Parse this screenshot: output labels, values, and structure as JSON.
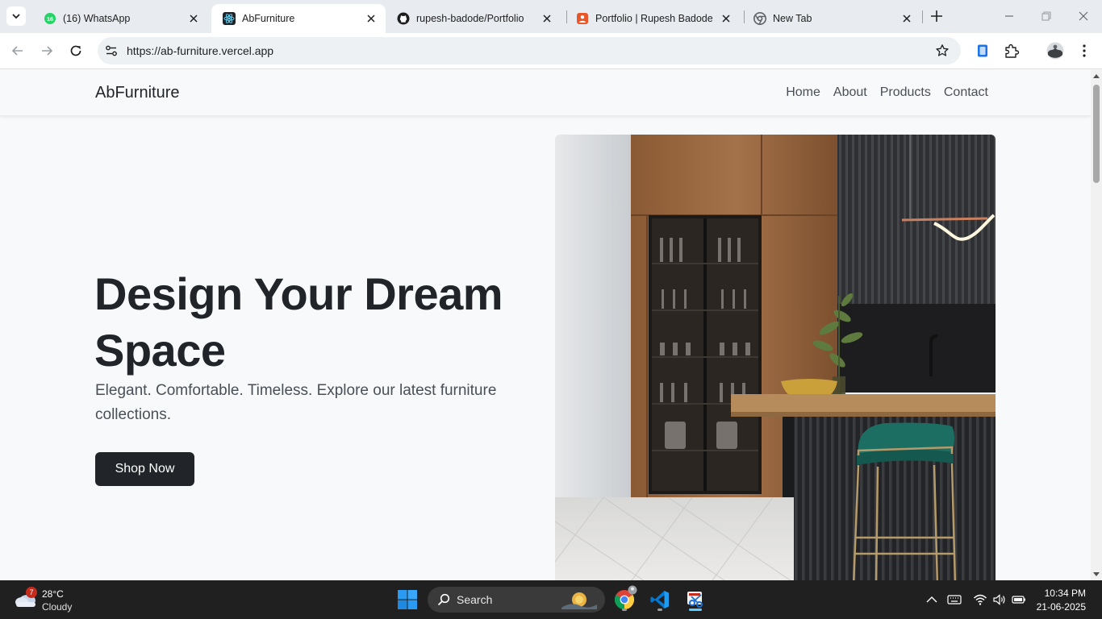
{
  "browser": {
    "tabs": [
      {
        "title": "(16) WhatsApp",
        "badge": "16"
      },
      {
        "title": "AbFurniture"
      },
      {
        "title": "rupesh-badode/Portfolio"
      },
      {
        "title": "Portfolio | Rupesh Badode"
      },
      {
        "title": "New Tab"
      }
    ],
    "url": "https://ab-furniture.vercel.app"
  },
  "site": {
    "brand": "AbFurniture",
    "nav": [
      "Home",
      "About",
      "Products",
      "Contact"
    ],
    "hero": {
      "title": "Design Your Dream Space",
      "subtitle": "Elegant. Comfortable. Timeless. Explore our latest furniture collections.",
      "cta": "Shop Now"
    }
  },
  "taskbar": {
    "weather": {
      "badge": "7",
      "temp": "28°C",
      "condition": "Cloudy"
    },
    "search_label": "Search",
    "time": "10:34 PM",
    "date": "21-06-2025"
  },
  "colors": {
    "page_bg": "#f8f9fa",
    "text_dark": "#212529",
    "button_bg": "#212529",
    "taskbar_bg": "#202020",
    "tabstrip_bg": "#e8ebf0"
  }
}
